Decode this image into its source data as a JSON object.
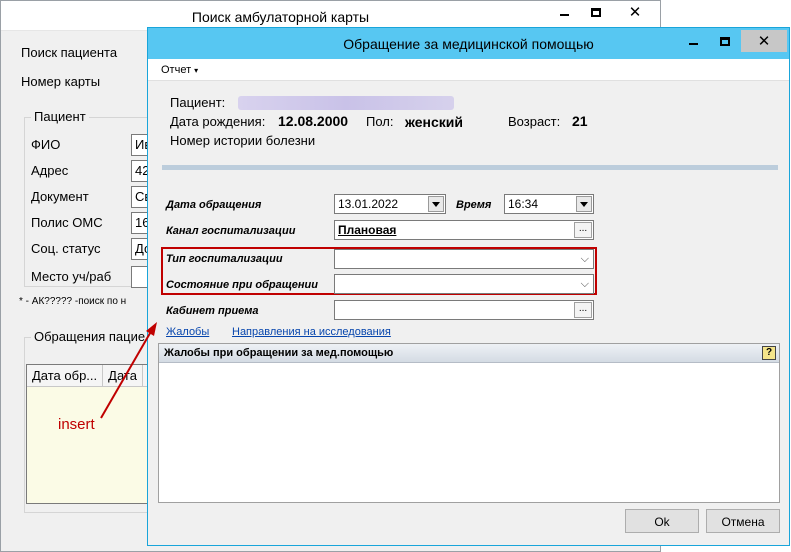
{
  "background_window": {
    "title": "Поиск амбулаторной карты",
    "search_patient_label": "Поиск пациента",
    "card_number_label": "Номер карты",
    "patient_group": {
      "legend": "Пациент",
      "fields": [
        {
          "label": "ФИО",
          "value": "Ив"
        },
        {
          "label": "Адрес",
          "value": "42"
        },
        {
          "label": "Документ",
          "value": "Св"
        },
        {
          "label": "Полис ОМС",
          "value": "16"
        },
        {
          "label": "Соц. статус",
          "value": "До"
        },
        {
          "label": "Место уч/раб",
          "value": ""
        }
      ]
    },
    "note": "* - АК????? -поиск по н",
    "visits_group": {
      "legend": "Обращения пацие",
      "columns": [
        "Дата обр...",
        "Дата"
      ]
    }
  },
  "annotation": {
    "text": "insert",
    "color": "#c00000"
  },
  "dialog": {
    "title": "Обращение за медицинской помощью",
    "menu": {
      "report_label": "Отчет",
      "arrow": "▾"
    },
    "patient": {
      "patient_label": "Пациент:",
      "birth_label": "Дата рождения:",
      "birth_value": "12.08.2000",
      "sex_label": "Пол:",
      "sex_value": "женский",
      "age_label": "Возраст:",
      "age_value": "21",
      "history_label": "Номер истории болезни"
    },
    "form": {
      "visit_date_label": "Дата обращения",
      "visit_date_value": "13.01.2022",
      "time_label": "Время",
      "time_value": "16:34",
      "channel_label": "Канал госпитализации",
      "channel_value": "Плановая",
      "hosp_type_label": "Тип госпитализации",
      "hosp_type_value": "",
      "state_label": "Состояние при обращении",
      "state_value": "",
      "cabinet_label": "Кабинет приема",
      "cabinet_value": ""
    },
    "links": {
      "complaints": "Жалобы",
      "referrals": "Направления на исследования"
    },
    "complaints_panel": {
      "header": "Жалобы при обращении за мед.помощью",
      "help": "?"
    },
    "buttons": {
      "ok": "Ok",
      "cancel": "Отмена"
    }
  }
}
